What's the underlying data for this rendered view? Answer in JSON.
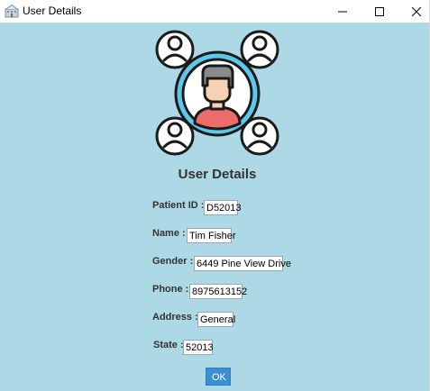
{
  "window": {
    "title": "User Details",
    "app_icon": "java-app-icon",
    "controls": {
      "minimize": "minimize-icon",
      "maximize": "maximize-icon",
      "close": "close-icon"
    }
  },
  "main": {
    "logo_icon": "user-network-icon",
    "heading": "User Details",
    "fields": [
      {
        "label": "Patient ID :",
        "value": "D52013"
      },
      {
        "label": "Name :",
        "value": "Tim Fisher"
      },
      {
        "label": "Gender :",
        "value": "6449 Pine View Drive"
      },
      {
        "label": "Phone :",
        "value": "8975613152"
      },
      {
        "label": "Address :",
        "value": "General"
      },
      {
        "label": "State :",
        "value": "52013"
      }
    ],
    "ok_label": "OK"
  },
  "colors": {
    "background": "#add8e6",
    "button": "#3a8fd0",
    "heading_text": "#333333"
  }
}
